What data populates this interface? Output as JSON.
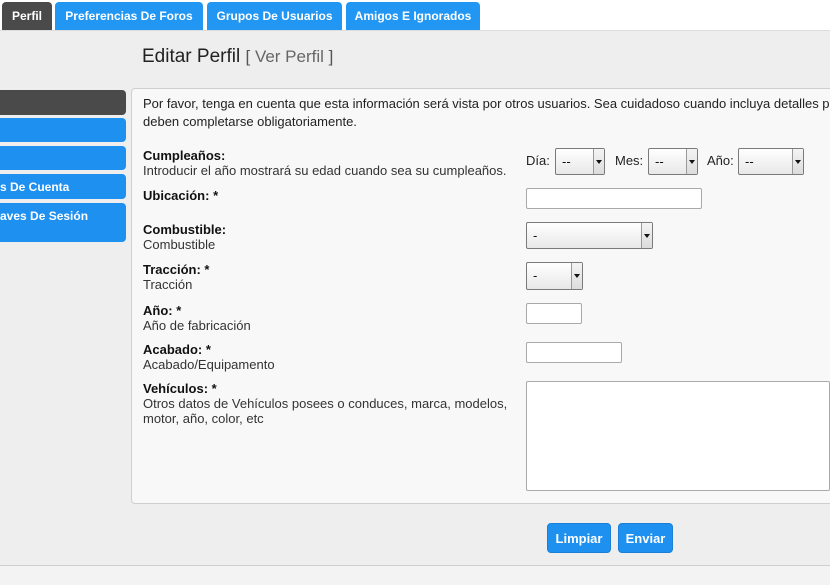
{
  "tabs": [
    {
      "label": "Perfil",
      "active": true
    },
    {
      "label": "Preferencias De Foros",
      "active": false
    },
    {
      "label": "Grupos De Usuarios",
      "active": false
    },
    {
      "label": "Amigos E Ignorados",
      "active": false
    }
  ],
  "page": {
    "title": "Editar Perfil",
    "view_link": "Ver Perfil"
  },
  "sidebar": {
    "items": [
      {
        "label": ""
      },
      {
        "label": ""
      },
      {
        "label": ""
      },
      {
        "label": "s De Cuenta"
      },
      {
        "label": "aves De Sesión"
      }
    ]
  },
  "intro": {
    "line1": "Por favor, tenga en cuenta que esta información será vista por otros usuarios. Sea cuidadoso cuando incluya detalles p",
    "line2": "deben completarse obligatoriamente."
  },
  "form": {
    "birthday": {
      "label": "Cumpleaños:",
      "desc": "Introducir el año mostrará su edad cuando sea su cumpleaños.",
      "day_label": "Día:",
      "day_value": "--",
      "month_label": "Mes:",
      "month_value": "--",
      "year_label": "Año:",
      "year_value": "--"
    },
    "location": {
      "label": "Ubicación: *",
      "value": ""
    },
    "fuel": {
      "label": "Combustible:",
      "desc": "Combustible",
      "value": "-"
    },
    "traction": {
      "label": "Tracción: *",
      "desc": "Tracción",
      "value": "-"
    },
    "year": {
      "label": "Año: *",
      "desc": "Año de fabricación",
      "value": ""
    },
    "trim": {
      "label": "Acabado: *",
      "desc": "Acabado/Equipamento",
      "value": ""
    },
    "vehicles": {
      "label": "Vehículos: *",
      "desc_line1": "Otros datos de Vehículos posees o conduces, marca, modelos,",
      "desc_line2": "motor, año, color, etc",
      "value": ""
    }
  },
  "buttons": {
    "reset": "Limpiar",
    "submit": "Enviar"
  },
  "colors": {
    "accent": "#2196f3",
    "active_tab": "#4a4a4a",
    "background": "#eeeeee"
  }
}
